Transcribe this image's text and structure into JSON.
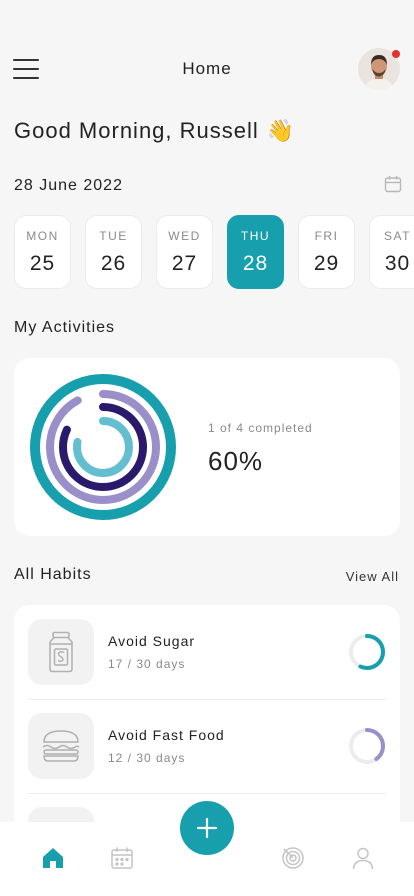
{
  "header": {
    "title": "Home",
    "menu_icon": "hamburger-menu-icon",
    "avatar_icon": "user-avatar",
    "notification_color": "#e53030"
  },
  "greeting": {
    "text": "Good Morning, Russell",
    "emoji": "👋"
  },
  "date": {
    "label": "28 June 2022",
    "icon": "calendar-icon"
  },
  "days": [
    {
      "name": "MON",
      "num": "25",
      "active": false
    },
    {
      "name": "TUE",
      "num": "26",
      "active": false
    },
    {
      "name": "WED",
      "num": "27",
      "active": false
    },
    {
      "name": "THU",
      "num": "28",
      "active": true
    },
    {
      "name": "FRI",
      "num": "29",
      "active": false
    },
    {
      "name": "SAT",
      "num": "30",
      "active": false
    }
  ],
  "activities": {
    "title": "My Activities",
    "completed_text": "1 of 4 completed",
    "percent_text": "60%",
    "rings": [
      {
        "color": "#179fae",
        "fraction": 1.0
      },
      {
        "color": "#9b8fc9",
        "fraction": 0.92
      },
      {
        "color": "#2b1a6b",
        "fraction": 0.82
      },
      {
        "color": "#63bfd0",
        "fraction": 0.78
      }
    ]
  },
  "habits": {
    "title": "All Habits",
    "view_all": "View All",
    "items": [
      {
        "name": "Avoid Sugar",
        "days": "17 / 30 days",
        "icon": "sugar-jar-icon",
        "color": "#179fae",
        "fraction": 0.5667
      },
      {
        "name": "Avoid Fast Food",
        "days": "12 / 30 days",
        "icon": "burger-icon",
        "color": "#9b8fc9",
        "fraction": 0.4
      }
    ]
  },
  "nav": {
    "items": [
      "home-icon",
      "calendar-icon",
      "target-icon",
      "profile-icon"
    ],
    "fab": "plus-icon",
    "accent": "#179fae"
  }
}
